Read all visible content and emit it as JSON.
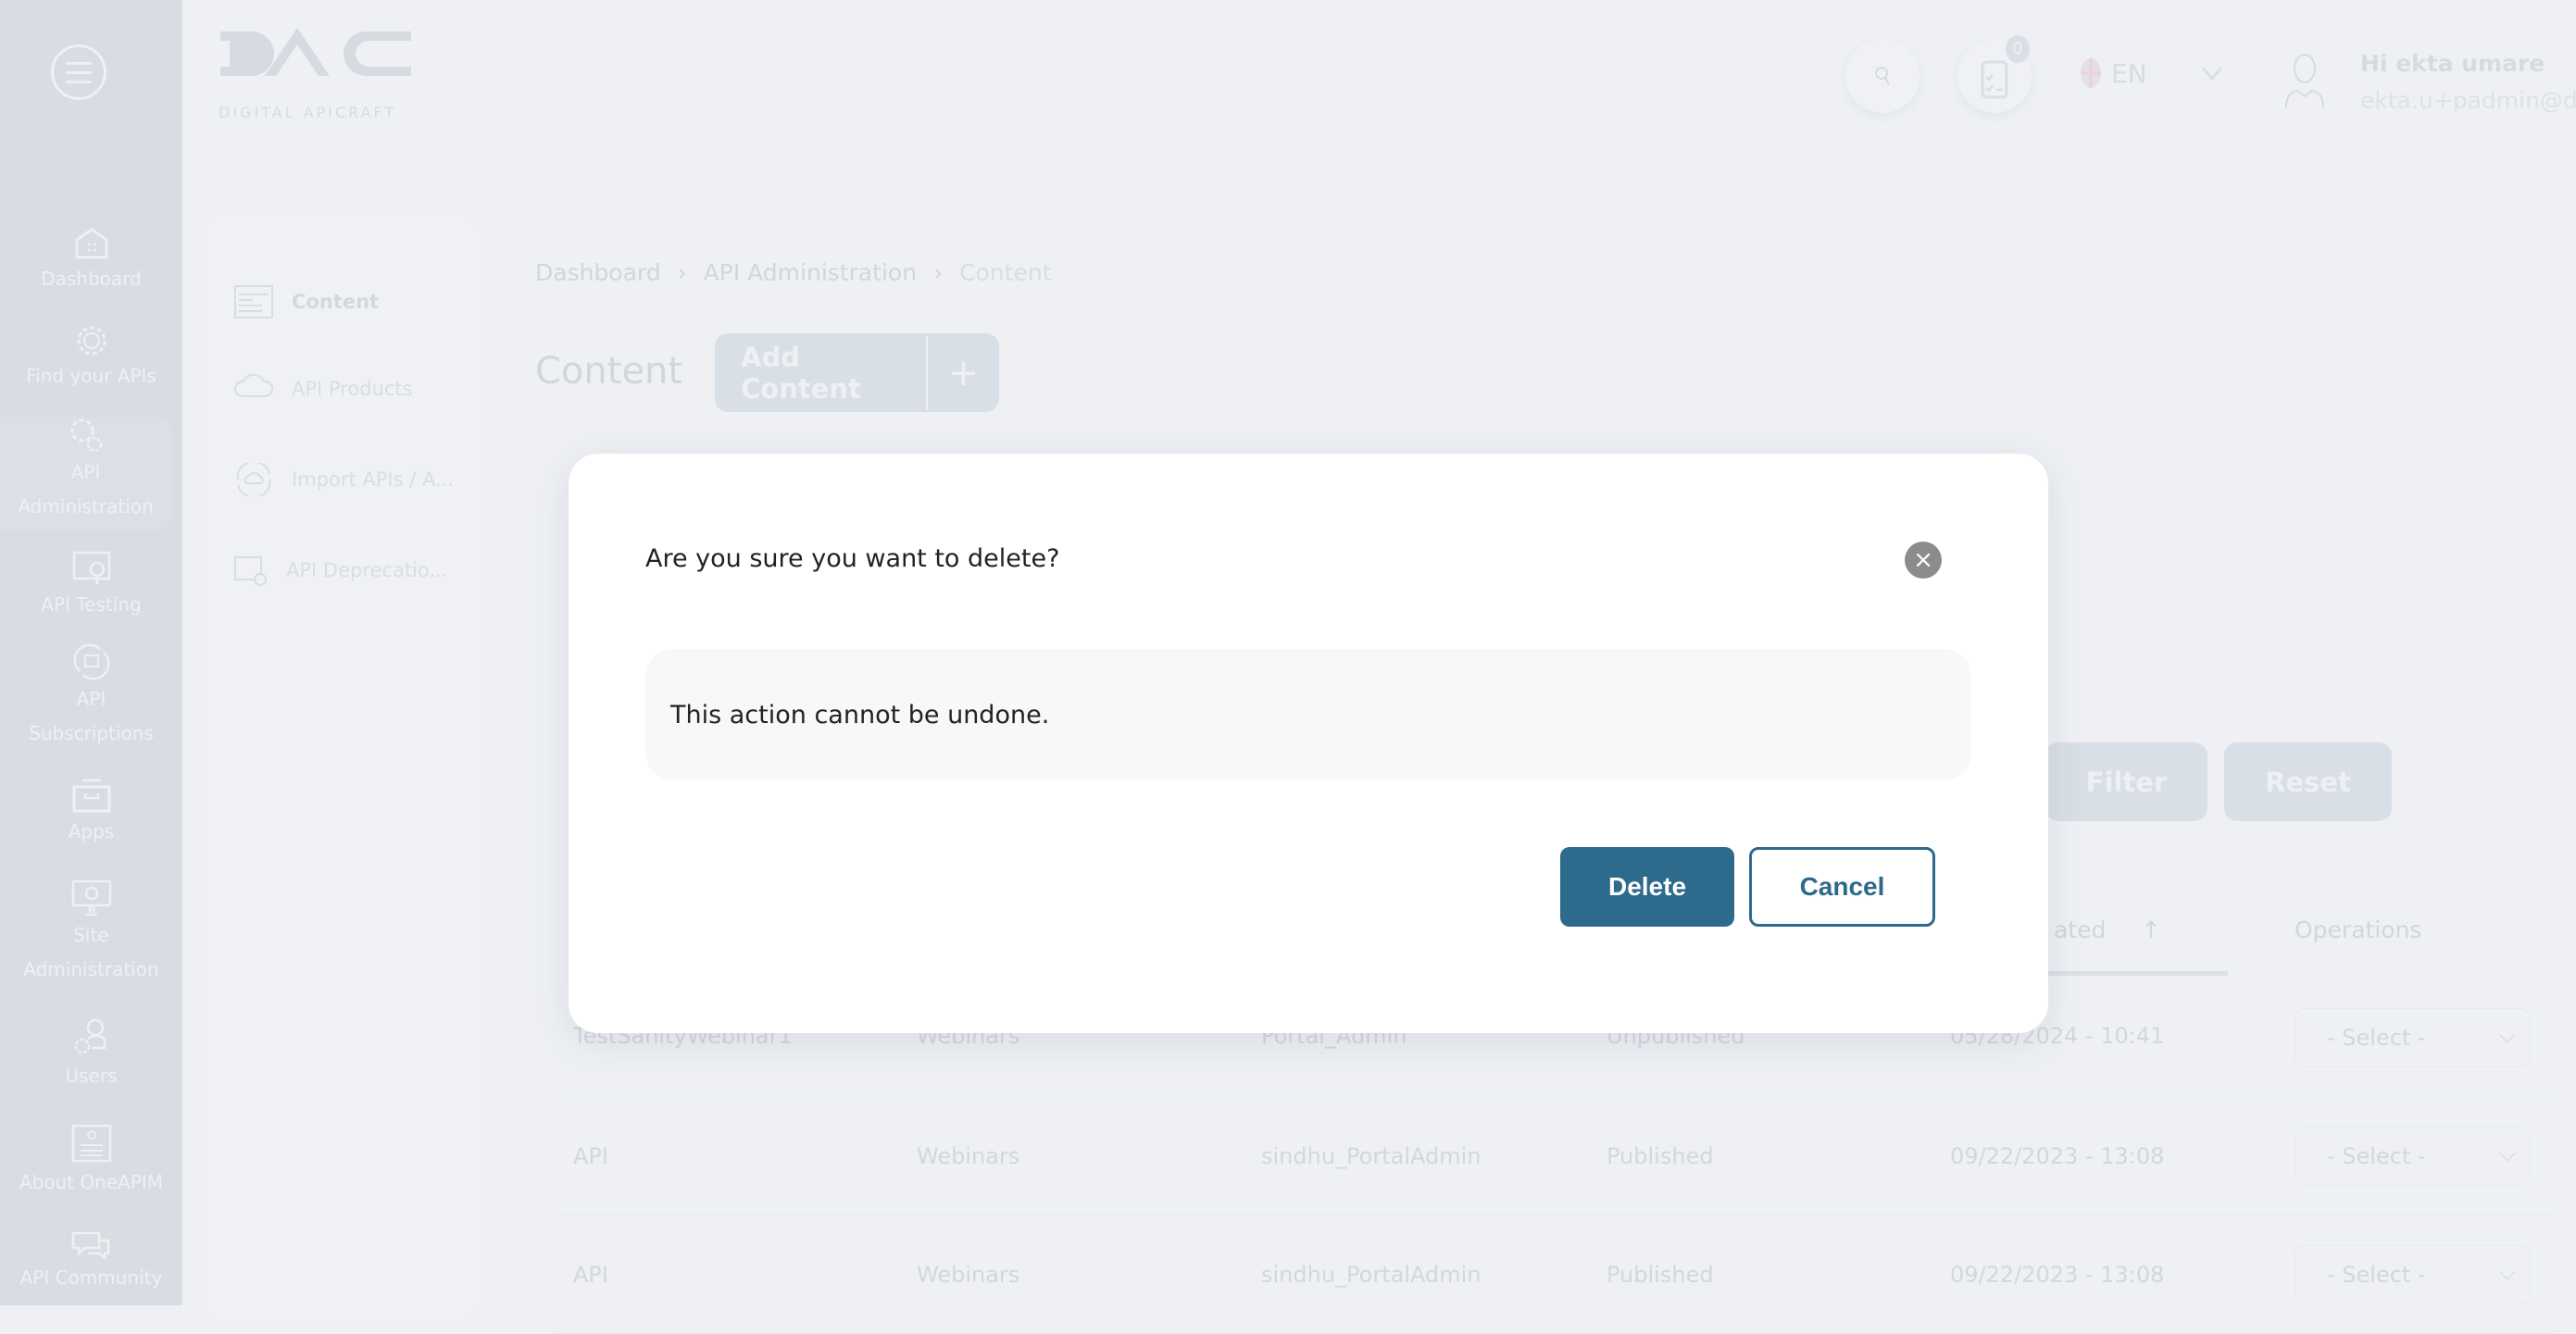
{
  "brand": {
    "logo_text": "DAC",
    "logo_subtitle": "DIGITAL APICRAFT"
  },
  "sidebar": {
    "items": [
      {
        "label": "Dashboard",
        "icon": "home-icon"
      },
      {
        "label": "Find your APIs",
        "icon": "api-gear-icon"
      },
      {
        "label": "API Administration",
        "icon": "gears-icon",
        "active": true
      },
      {
        "label": "API Testing",
        "icon": "testing-icon"
      },
      {
        "label": "API Subscriptions",
        "icon": "subscriptions-icon"
      },
      {
        "label": "Apps",
        "icon": "archive-box-icon"
      },
      {
        "label": "Site Administration",
        "icon": "monitor-gear-icon"
      },
      {
        "label": "Users",
        "icon": "user-gear-icon"
      },
      {
        "label": "About OneAPIM",
        "icon": "info-document-icon"
      },
      {
        "label": "API Community",
        "icon": "chat-bubbles-icon"
      }
    ]
  },
  "subnav": {
    "items": [
      {
        "label": "Content",
        "active": true
      },
      {
        "label": "API Products"
      },
      {
        "label": "Import APIs / A..."
      },
      {
        "label": "API Deprecatio..."
      }
    ]
  },
  "header": {
    "task_count": "0",
    "language": "EN",
    "greeting": "Hi ekta umare",
    "email": "ekta.u+padmin@d..."
  },
  "breadcrumb": [
    "Dashboard",
    "API Administration",
    "Content"
  ],
  "page": {
    "title": "Content",
    "add_label": "Add Content",
    "add_icon": "+"
  },
  "filters": {
    "filter_label": "Filter",
    "reset_label": "Reset"
  },
  "table": {
    "headers": {
      "updated": "ated",
      "operations": "Operations"
    },
    "rows": [
      [
        "TestSanityWebinar1",
        "Webinars",
        "Portal_Admin",
        "Unpublished",
        "05/28/2024 - 10:41",
        "- Select -"
      ],
      [
        "API",
        "Webinars",
        "sindhu_PortalAdmin",
        "Published",
        "09/22/2023 - 13:08",
        "- Select -"
      ],
      [
        "API",
        "Webinars",
        "sindhu_PortalAdmin",
        "Published",
        "09/22/2023 - 13:08",
        "- Select -"
      ]
    ]
  },
  "modal": {
    "title": "Are you sure you want to delete?",
    "message": "This action cannot be undone.",
    "delete_label": "Delete",
    "cancel_label": "Cancel",
    "close_icon": "×"
  },
  "colors": {
    "primary": "#2d6a8c",
    "close": "#8c8c8c"
  }
}
